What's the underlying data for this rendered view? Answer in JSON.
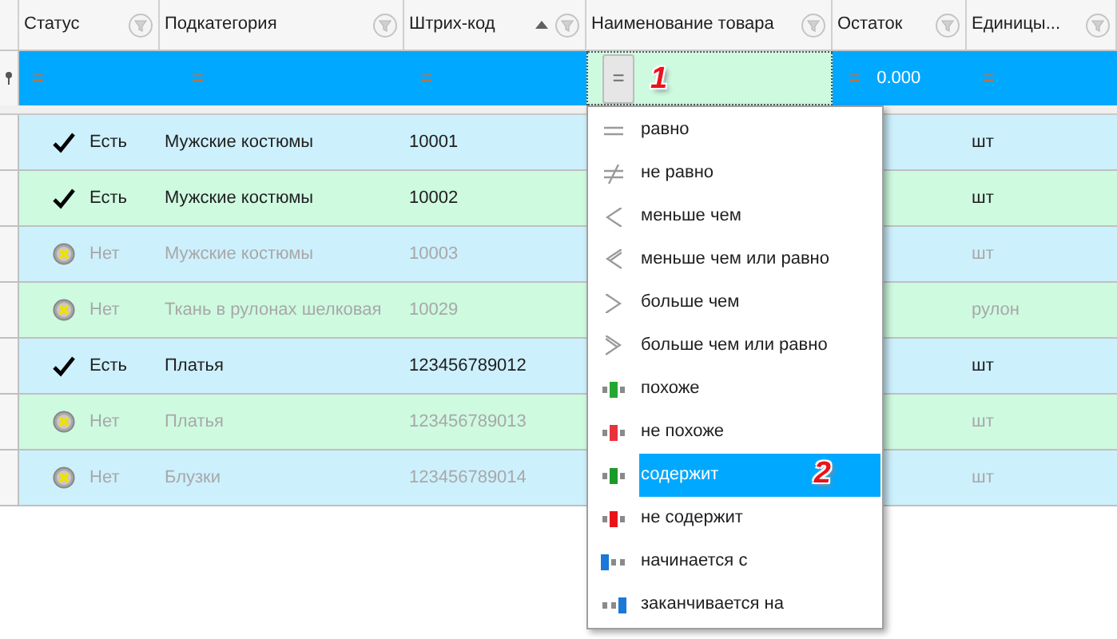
{
  "columns": [
    {
      "label": "Статус",
      "sorted_ascending": false
    },
    {
      "label": "Подкатегория",
      "sorted_ascending": false
    },
    {
      "label": "Штрих-код",
      "sorted_ascending": true
    },
    {
      "label": "Наименование товара",
      "sorted_ascending": false
    },
    {
      "label": "Остаток",
      "sorted_ascending": false
    },
    {
      "label": "Единицы...",
      "sorted_ascending": false
    }
  ],
  "filter_row": [
    {
      "operator": "=",
      "active": false
    },
    {
      "operator": "=",
      "active": false
    },
    {
      "operator": "=",
      "active": false
    },
    {
      "operator": "=",
      "active": true,
      "callout": "1"
    },
    {
      "operator": "=",
      "value": "0.000",
      "active": false
    },
    {
      "operator": "=",
      "active": false
    }
  ],
  "rows": [
    {
      "kind": "yes",
      "status_label": "Есть",
      "subcategory": "Мужские костюмы",
      "barcode": "10001",
      "unit": "шт"
    },
    {
      "kind": "yes",
      "status_label": "Есть",
      "subcategory": "Мужские костюмы",
      "barcode": "10002",
      "unit": "шт"
    },
    {
      "kind": "no",
      "status_label": "Нет",
      "subcategory": "Мужские костюмы",
      "barcode": "10003",
      "unit": "шт"
    },
    {
      "kind": "no",
      "status_label": "Нет",
      "subcategory": "Ткань в рулонах шелковая",
      "barcode": "10029",
      "unit": "рулон"
    },
    {
      "kind": "yes",
      "status_label": "Есть",
      "subcategory": "Платья",
      "barcode": "123456789012",
      "unit": "шт"
    },
    {
      "kind": "no",
      "status_label": "Нет",
      "subcategory": "Платья",
      "barcode": "123456789013",
      "unit": "шт"
    },
    {
      "kind": "no",
      "status_label": "Нет",
      "subcategory": "Блузки",
      "barcode": "123456789014",
      "unit": "шт"
    }
  ],
  "operator_menu": [
    {
      "kind": "eq",
      "label": "равно",
      "selected": false
    },
    {
      "kind": "ne",
      "label": "не равно",
      "selected": false
    },
    {
      "kind": "lt",
      "label": "меньше чем",
      "selected": false
    },
    {
      "kind": "le",
      "label": "меньше чем или равно",
      "selected": false
    },
    {
      "kind": "gt",
      "label": "больше чем",
      "selected": false
    },
    {
      "kind": "ge",
      "label": "больше чем или равно",
      "selected": false
    },
    {
      "kind": "like",
      "label": "похоже",
      "selected": false
    },
    {
      "kind": "notlike",
      "label": "не похоже",
      "selected": false
    },
    {
      "kind": "contains",
      "label": "содержит",
      "selected": true,
      "callout": "2"
    },
    {
      "kind": "notcontains",
      "label": "не содержит",
      "selected": false
    },
    {
      "kind": "starts",
      "label": "начинается с",
      "selected": false
    },
    {
      "kind": "ends",
      "label": "заканчивается на",
      "selected": false
    }
  ]
}
